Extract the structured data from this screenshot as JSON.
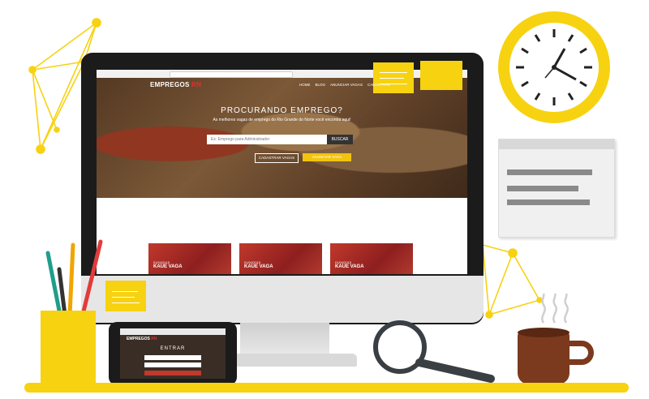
{
  "browser": {
    "brand": "EMPREGOS",
    "brand_suffix": "RN",
    "nav": [
      "HOME",
      "BLOG",
      "ANUNCIAR VAGAS",
      "CADASTRAR"
    ]
  },
  "hero": {
    "title": "PROCURANDO EMPREGO?",
    "subtitle": "As melhores vagas de emprego do Rio Grande do Norte você encontra aqui!",
    "search_placeholder": "Ex: Emprego para Administrador",
    "search_button": "BUSCAR",
    "cadastrar_button": "CADASTRAR VAGAS",
    "yellow_button": "ANUNCIAR VAGA"
  },
  "cards": [
    {
      "date": "01/04/2015",
      "title": "KAUE VAGA"
    },
    {
      "date": "01/04/2015",
      "title": "KAUE VAGA"
    },
    {
      "date": "01/04/2015",
      "title": "KAUE VAGA"
    }
  ],
  "phone": {
    "brand": "EMPREGOS",
    "brand_suffix": "RN",
    "heading": "ENTRAR"
  },
  "colors": {
    "accent": "#f7d211",
    "brand_red": "#e03030",
    "coffee": "#7b3a1e"
  }
}
